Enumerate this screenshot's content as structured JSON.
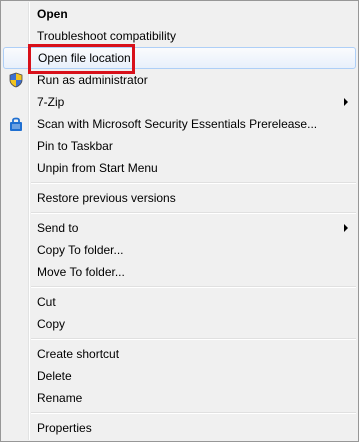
{
  "menu": {
    "open": "Open",
    "troubleshoot": "Troubleshoot compatibility",
    "open_file_location": "Open file location",
    "run_as_admin": "Run as administrator",
    "seven_zip": "7-Zip",
    "scan": "Scan with Microsoft Security Essentials Prerelease...",
    "pin_taskbar": "Pin to Taskbar",
    "unpin_start": "Unpin from Start Menu",
    "restore_versions": "Restore previous versions",
    "send_to": "Send to",
    "copy_to_folder": "Copy To folder...",
    "move_to_folder": "Move To folder...",
    "cut": "Cut",
    "copy": "Copy",
    "create_shortcut": "Create shortcut",
    "delete": "Delete",
    "rename": "Rename",
    "properties": "Properties"
  },
  "icons": {
    "run_as_admin": "uac-shield-icon",
    "scan": "security-essentials-icon",
    "submenu": "chevron-right-icon"
  },
  "colors": {
    "highlight_border": "#d8101a",
    "hover_border": "#aecff7",
    "menu_background": "#f0f0f0"
  }
}
